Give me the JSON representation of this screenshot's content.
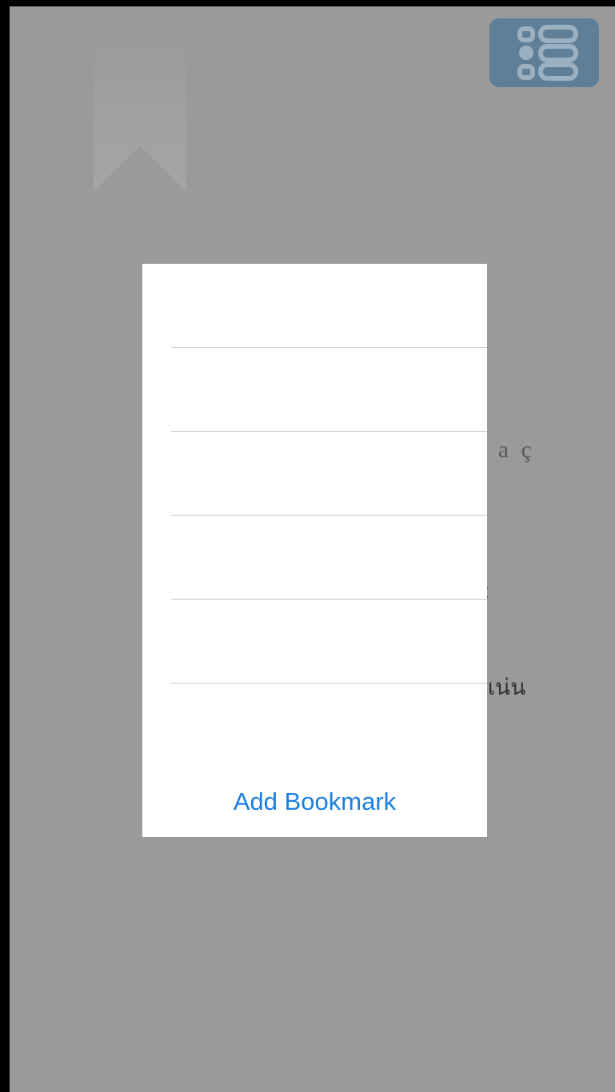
{
  "background": {
    "overlay_color": "#9a9a9a",
    "accent_color": "#5e7f97",
    "visible_text_fragments": [
      "i a ç",
      ":",
      "แน่น"
    ]
  },
  "menu_button": {
    "icon": "list-icon"
  },
  "bookmark_ribbon": {
    "icon": "bookmark-icon"
  },
  "popover": {
    "rows": [
      {
        "label": ""
      },
      {
        "label": ""
      },
      {
        "label": ""
      },
      {
        "label": ""
      },
      {
        "label": ""
      }
    ],
    "add_bookmark_label": "Add Bookmark",
    "add_bookmark_color": "#1a7fe0"
  }
}
